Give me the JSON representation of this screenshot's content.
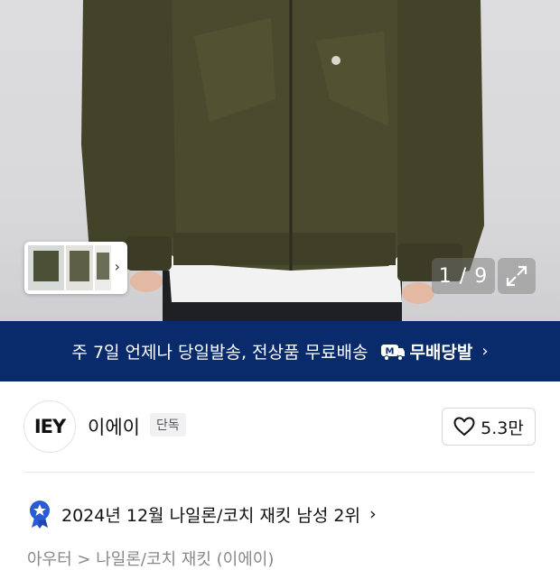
{
  "gallery": {
    "counter": "1 / 9",
    "thumbnail_chevron": "›",
    "expand_icon": "expand-icon"
  },
  "banner": {
    "text": "주 7일 언제나 당일발송, 전상품 무료배송",
    "badge_label": "무배당발",
    "chevron": "›",
    "background": "#0a2b6b"
  },
  "brand": {
    "logo_text": "IEY",
    "name": "이에이",
    "tag": "단독",
    "likes": "5.3만"
  },
  "ranking": {
    "text": "2024년 12월 나일론/코치 재킷 남성 2위",
    "chevron": "›"
  },
  "breadcrumb": {
    "text": "아우터 > 나일론/코치 재킷 (이에이)"
  }
}
